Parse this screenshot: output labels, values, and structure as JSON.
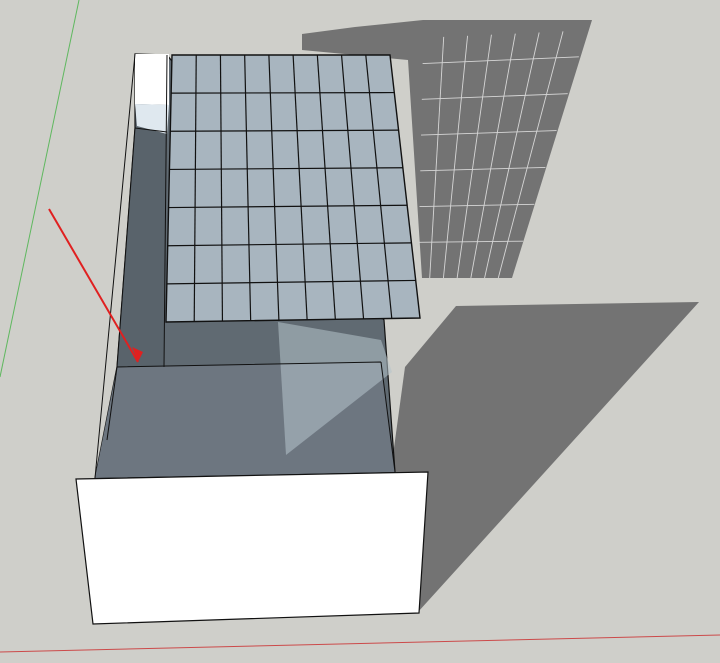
{
  "viewport": {
    "background": "#cfcfca",
    "colors": {
      "ground_shadow": "#737373",
      "panel_fill": "#a8b5bf",
      "panel_stroke": "#111111",
      "box_interior": "#606a72",
      "box_floor": "#6d7680",
      "face_white": "#ffffff",
      "glass_highlight": "#b7c4cc",
      "axis_green": "#5fb85f",
      "axis_red": "#cc4a4a",
      "annotation_arrow": "#e02020"
    },
    "panel_grid": {
      "rows": 7,
      "cols": 9
    },
    "shadow_grid": {
      "rows": 7,
      "cols": 7
    },
    "elements": [
      "ground-plane",
      "green-axis-line",
      "red-axis-line",
      "panel-shadow",
      "box-shadow",
      "open-box",
      "solar-panel-array",
      "annotation-arrow",
      "front-wall"
    ]
  }
}
